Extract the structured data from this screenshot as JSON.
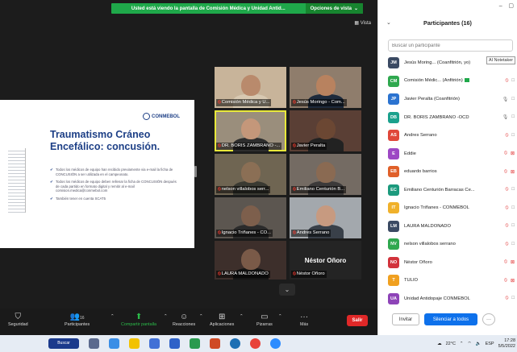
{
  "zoom": {
    "share_banner": "Usted está viendo la pantalla de Comisión Médica y Unidad Antid...",
    "view_options": "Opciones de vista",
    "view_button": "Vista"
  },
  "slide": {
    "brand": "CONMEBOL",
    "title": "Traumatismo Cráneo Encefálico: concusión.",
    "bullets": [
      "Todos los médicos de equipo han recibido previamente via e-mail la ficha de CONCUSIÓN a ser utilizada en el campeonato.",
      "Todos los médicos de equipo deben rellenar la ficha de CONCUSIÓN después de cada partido en formato digital y remitir al e-mail comision.medica@conmebol.com",
      "También tener en cuenta SCAT5"
    ]
  },
  "tiles": [
    {
      "name": "Comisión Médica y U...",
      "skin": "#b98a6c",
      "shirt": "#d8c9b2",
      "bg": "#c8b49a"
    },
    {
      "name": "Jesús Moringo - Com...",
      "skin": "#b8825f",
      "shirt": "#1d2a3c",
      "bg": "#8f7d6c"
    },
    {
      "name": "DR. BORIS ZAMBRANO -...",
      "skin": "#c4977a",
      "shirt": "#2d2d2d",
      "bg": "#9a8e7c"
    },
    {
      "name": "Javier Peralta",
      "skin": "#6b4733",
      "shirt": "#222",
      "bg": "#5a3f35"
    },
    {
      "name": "nelson villalobos serr...",
      "skin": "#8b6f55",
      "shirt": "#3a3a32",
      "bg": "#6f6552"
    },
    {
      "name": "Emiliano Centurión B...",
      "skin": "#8a6a52",
      "shirt": "#3c3a3a",
      "bg": "#746b63"
    },
    {
      "name": "Ignacio Triñanes - CO...",
      "skin": "#7d5f4c",
      "shirt": "#2b2b2b",
      "bg": "#5c5650"
    },
    {
      "name": "Andres Serrano",
      "skin": "#c79a80",
      "shirt": "#394049",
      "bg": "#a3a8ad"
    },
    {
      "name": "LAURA MALDONADO",
      "skin": "#7a5a48",
      "shirt": "#141414",
      "bg": "#3d2f2b"
    },
    {
      "name": "Néstor Oñoro",
      "bigname": "Néstor Oñoro",
      "skin": "",
      "shirt": "",
      "bg": "#242424"
    }
  ],
  "toolbar": {
    "security": "Seguridad",
    "participants": "Participantes",
    "participants_count": "16",
    "share": "Compartir pantalla",
    "reactions": "Reacciones",
    "apps": "Aplicaciones",
    "boards": "Pizarras",
    "more": "Más",
    "leave": "Salir"
  },
  "panel": {
    "title": "Participantes (16)",
    "search_placeholder": "Buscar un participante",
    "tooltip": "AI Notetaker",
    "invite": "Invitar",
    "mute_all": "Silenciar a todos",
    "more": "···",
    "participants": [
      {
        "initials": "JM",
        "name": "Jesús Moring... (Coanfitrión, yo)",
        "color": "#3b4a63",
        "mic": "",
        "cam": ""
      },
      {
        "initials": "CM",
        "name": "Comisión Médic... (Anfitrión)",
        "color": "#2fa84f",
        "mic": "muted",
        "cam": "□"
      },
      {
        "initials": "JP",
        "name": "Javier Peralta (Coanfitrión)",
        "color": "#2b73d0",
        "mic": "on",
        "cam": "□"
      },
      {
        "initials": "DB",
        "name": "DR. BORIS ZAMBRANO -OCD",
        "color": "#1ba18d",
        "mic": "on",
        "cam": "□"
      },
      {
        "initials": "AS",
        "name": "Andres Serrano",
        "color": "#e0473a",
        "mic": "muted",
        "cam": "□"
      },
      {
        "initials": "E",
        "name": "Eddie",
        "color": "#9d47c4",
        "mic": "muted",
        "cam": "⊠"
      },
      {
        "initials": "EB",
        "name": "eduardo barrios",
        "color": "#e0602a",
        "mic": "muted",
        "cam": "⊠"
      },
      {
        "initials": "EC",
        "name": "Emiliano Centurión Barracas Ce...",
        "color": "#1c9a7d",
        "mic": "muted",
        "cam": "□"
      },
      {
        "initials": "IT",
        "name": "Ignacio Triñanes - CONMEBOL",
        "color": "#f0b12b",
        "mic": "muted",
        "cam": "□"
      },
      {
        "initials": "LM",
        "name": "LAURA MALDONADO",
        "color": "#3b4a63",
        "mic": "muted",
        "cam": "□"
      },
      {
        "initials": "NV",
        "name": "nelson villalobos serrano",
        "color": "#2fa84f",
        "mic": "muted",
        "cam": "□"
      },
      {
        "initials": "NO",
        "name": "Néstor Oñoro",
        "color": "#d2333c",
        "mic": "muted",
        "cam": "⊠"
      },
      {
        "initials": "T",
        "name": "TULIO",
        "color": "#f0a020",
        "mic": "muted",
        "cam": "⊠"
      },
      {
        "initials": "UA",
        "name": "Unidad Antidopaje CONMEBOL",
        "color": "#8e44b8",
        "mic": "muted",
        "cam": "□"
      }
    ]
  },
  "taskbar": {
    "start_label": "Buscar",
    "weather": "22°C",
    "lang": "ESP",
    "time": "17:28",
    "date": "5/5/2022"
  }
}
